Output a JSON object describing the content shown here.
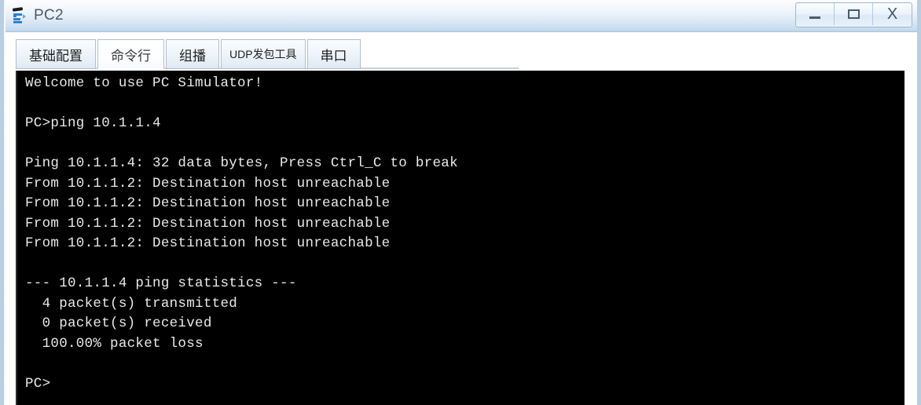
{
  "window": {
    "title": "PC2",
    "icon": "pc-network-icon",
    "controls": {
      "minimize_label": "—",
      "maximize_label": "❐",
      "close_label": "X"
    }
  },
  "tabs": [
    {
      "label": "基础配置",
      "name": "tab-basic-config",
      "active": false,
      "small": false
    },
    {
      "label": "命令行",
      "name": "tab-command-line",
      "active": true,
      "small": false
    },
    {
      "label": "组播",
      "name": "tab-multicast",
      "active": false,
      "small": false
    },
    {
      "label": "UDP发包工具",
      "name": "tab-udp-tool",
      "active": false,
      "small": true
    },
    {
      "label": "串口",
      "name": "tab-serial-port",
      "active": false,
      "small": false
    }
  ],
  "terminal": {
    "lines": [
      "Welcome to use PC Simulator!",
      "",
      "PC>ping 10.1.1.4",
      "",
      "Ping 10.1.1.4: 32 data bytes, Press Ctrl_C to break",
      "From 10.1.1.2: Destination host unreachable",
      "From 10.1.1.2: Destination host unreachable",
      "From 10.1.1.2: Destination host unreachable",
      "From 10.1.1.2: Destination host unreachable",
      "",
      "--- 10.1.1.4 ping statistics ---",
      "  4 packet(s) transmitted",
      "  0 packet(s) received",
      "  100.00% packet loss",
      "",
      "PC>"
    ],
    "background_color": "#000000",
    "text_color": "#e9e9e9"
  }
}
